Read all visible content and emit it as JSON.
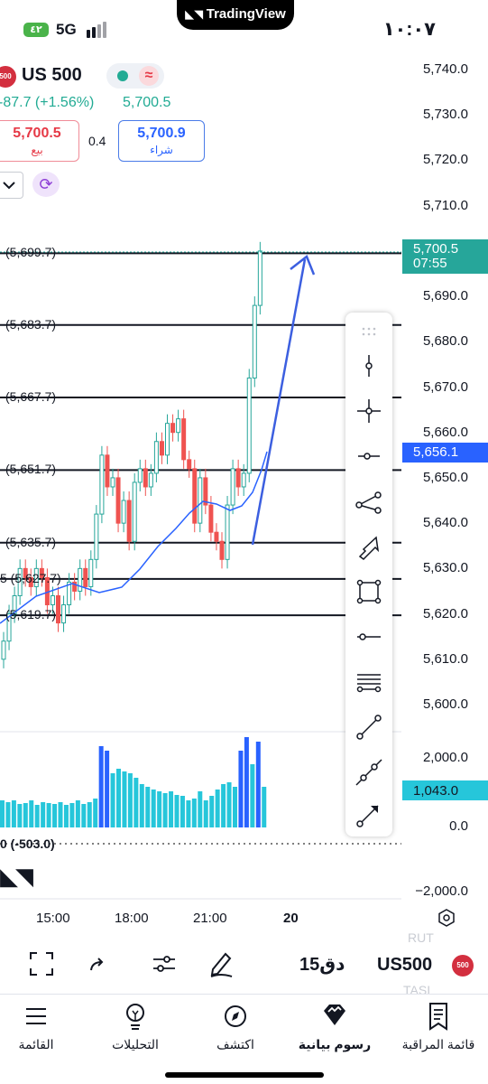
{
  "status_bar": {
    "time": "١٠:٠٧",
    "network": "5G",
    "signal_badge": "٤٢",
    "app_pill": "TradingView"
  },
  "header": {
    "logo_text": "500",
    "symbol": "US 500",
    "change": "-87.7 (+1.56%)",
    "last_price": "5,700.5",
    "sell_price": "5,700.5",
    "sell_label": "بيع",
    "spread": "0.4",
    "buy_price": "5,700.9",
    "buy_label": "شراء",
    "refresh_icon": "refresh-icon",
    "chevron_icon": "chevron-down-icon"
  },
  "price_axis": {
    "labels": [
      "5,740.0",
      "5,730.0",
      "5,720.0",
      "5,710.0",
      "5,690.0",
      "5,680.0",
      "5,670.0",
      "5,660.0",
      "5,650.0",
      "5,640.0",
      "5,630.0",
      "5,620.0",
      "5,610.0",
      "5,600.0"
    ],
    "current_price": "5,700.5",
    "countdown": "07:55",
    "cursor_price": "5,656.1",
    "volume_labels": [
      "2,000.0",
      "0.0",
      "−2,000.0"
    ],
    "volume_tag": "1,043.0"
  },
  "horizontal_lines": [
    {
      "label": "(5,699.7)",
      "value": 5699.7
    },
    {
      "label": "(5,683.7)",
      "value": 5683.7
    },
    {
      "label": "(5,667.7)",
      "value": 5667.7
    },
    {
      "label": "(5,651.7)",
      "value": 5651.7
    },
    {
      "label": "(5,635.7)",
      "value": 5635.7
    },
    {
      "label": "5 (5,627.7)",
      "value": 5627.7
    },
    {
      "label": "(5,619.7)",
      "value": 5619.7
    }
  ],
  "indicator_label": "0 (-503.0)",
  "time_axis": [
    "15:00",
    "18:00",
    "21:00",
    "20"
  ],
  "drawing_tools": [
    "drag-handle-icon",
    "vertical-line-icon",
    "cross-line-icon",
    "horizontal-ray-icon",
    "path-icon",
    "arrow-marker-icon",
    "rectangle-icon",
    "horizontal-line-icon",
    "parallel-lines-icon",
    "trend-line-icon",
    "extended-line-icon",
    "arrow-line-icon"
  ],
  "toolbar": {
    "symbol": "US500",
    "logo_text": "500",
    "interval": "15دق",
    "faded_top": "RUT",
    "faded_bottom": "TASI"
  },
  "bottom_nav": {
    "watchlist": "قائمة المراقبة",
    "charts": "رسوم بيانية",
    "explore": "اكتشف",
    "analytics": "التحليلات",
    "menu": "القائمة"
  },
  "colors": {
    "up": "#26a69a",
    "down": "#ef5350",
    "accent": "#2962ff",
    "volume": "#26c6da"
  }
}
